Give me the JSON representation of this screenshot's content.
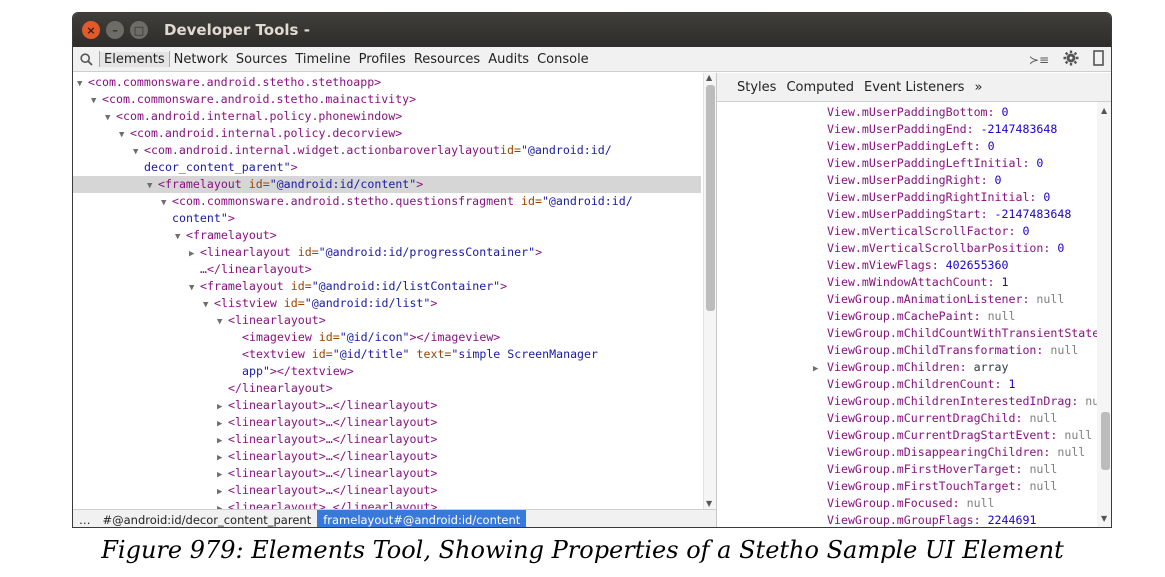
{
  "window": {
    "title": "Developer Tools -",
    "close_glyph": "×",
    "minimize_glyph": "–",
    "maximize_glyph": "□"
  },
  "toolbar": {
    "search_icon": "🔍",
    "tabs": [
      "Elements",
      "Network",
      "Sources",
      "Timeline",
      "Profiles",
      "Resources",
      "Audits",
      "Console"
    ],
    "active_tab": "Elements",
    "right_icons": {
      "console_drawer": "≻≡",
      "settings": "✱",
      "device": "▯"
    }
  },
  "elements_tree": [
    {
      "indent": 0,
      "exp": "▼",
      "tag": "<com.commonsware.android.stetho.stethoapp>"
    },
    {
      "indent": 1,
      "exp": "▼",
      "tag": "<com.commonsware.android.stetho.mainactivity>"
    },
    {
      "indent": 2,
      "exp": "▼",
      "tag": "<com.android.internal.policy.phonewindow>"
    },
    {
      "indent": 3,
      "exp": "▼",
      "tag": "<com.android.internal.policy.decorview>"
    },
    {
      "indent": 4,
      "exp": "▼",
      "tag": "<com.android.internal.widget.actionbaroverlaylayout",
      "attr": "id=",
      "val": "\"@android:id/"
    },
    {
      "indent": 4,
      "exp": "",
      "tag": "",
      "val": "decor_content_parent\"",
      "tail": ">"
    },
    {
      "indent": 5,
      "exp": "▼",
      "tag": "<framelayout",
      "attr": " id=",
      "val": "\"@android:id/content\"",
      "tail": ">",
      "sel": true
    },
    {
      "indent": 6,
      "exp": "▼",
      "tag": "<com.commonsware.android.stetho.questionsfragment",
      "attr": " id=",
      "val": "\"@android:id/"
    },
    {
      "indent": 6,
      "exp": "",
      "tag": "",
      "val": "content\"",
      "tail": ">"
    },
    {
      "indent": 7,
      "exp": "▼",
      "tag": "<framelayout>"
    },
    {
      "indent": 8,
      "exp": "▶",
      "tag": "<linearlayout",
      "attr": " id=",
      "val": "\"@android:id/progressContainer\"",
      "tail": ">"
    },
    {
      "indent": 8,
      "exp": "",
      "tag": "…</linearlayout>"
    },
    {
      "indent": 8,
      "exp": "▼",
      "tag": "<framelayout",
      "attr": " id=",
      "val": "\"@android:id/listContainer\"",
      "tail": ">"
    },
    {
      "indent": 9,
      "exp": "▼",
      "tag": "<listview",
      "attr": " id=",
      "val": "\"@android:id/list\"",
      "tail": ">"
    },
    {
      "indent": 10,
      "exp": "▼",
      "tag": "<linearlayout>"
    },
    {
      "indent": 11,
      "exp": "",
      "tag": "<imageview",
      "attr": " id=",
      "val": "\"@id/icon\"",
      "tail": "></imageview>"
    },
    {
      "indent": 11,
      "exp": "",
      "tag": "<textview",
      "attr": " id=",
      "val": "\"@id/title\"",
      "attr2": " text=",
      "val2": "\"simple ScreenManager"
    },
    {
      "indent": 11,
      "exp": "",
      "tag": "",
      "val": "app\"",
      "tail": "></textview>"
    },
    {
      "indent": 10,
      "exp": "",
      "tag": "</linearlayout>"
    },
    {
      "indent": 10,
      "exp": "▶",
      "tag": "<linearlayout>…</linearlayout>"
    },
    {
      "indent": 10,
      "exp": "▶",
      "tag": "<linearlayout>…</linearlayout>"
    },
    {
      "indent": 10,
      "exp": "▶",
      "tag": "<linearlayout>…</linearlayout>"
    },
    {
      "indent": 10,
      "exp": "▶",
      "tag": "<linearlayout>…</linearlayout>"
    },
    {
      "indent": 10,
      "exp": "▶",
      "tag": "<linearlayout>…</linearlayout>"
    },
    {
      "indent": 10,
      "exp": "▶",
      "tag": "<linearlayout>…</linearlayout>"
    },
    {
      "indent": 10,
      "exp": "▶",
      "tag": "<linearlayout>…</linearlayout>"
    }
  ],
  "breadcrumb": {
    "ellipsis": "…",
    "items": [
      "#@android:id/decor_content_parent",
      "framelayout#@android:id/content"
    ],
    "active_index": 1
  },
  "right_panel": {
    "tabs": [
      "Styles",
      "Computed",
      "Event Listeners",
      "»"
    ],
    "properties": [
      {
        "name": "View.mUserPaddingBottom",
        "value": "0",
        "kind": "num"
      },
      {
        "name": "View.mUserPaddingEnd",
        "value": "-2147483648",
        "kind": "num"
      },
      {
        "name": "View.mUserPaddingLeft",
        "value": "0",
        "kind": "num"
      },
      {
        "name": "View.mUserPaddingLeftInitial",
        "value": "0",
        "kind": "num"
      },
      {
        "name": "View.mUserPaddingRight",
        "value": "0",
        "kind": "num"
      },
      {
        "name": "View.mUserPaddingRightInitial",
        "value": "0",
        "kind": "num"
      },
      {
        "name": "View.mUserPaddingStart",
        "value": "-2147483648",
        "kind": "num"
      },
      {
        "name": "View.mVerticalScrollFactor",
        "value": "0",
        "kind": "num"
      },
      {
        "name": "View.mVerticalScrollbarPosition",
        "value": "0",
        "kind": "num"
      },
      {
        "name": "View.mViewFlags",
        "value": "402655360",
        "kind": "num"
      },
      {
        "name": "View.mWindowAttachCount",
        "value": "1",
        "kind": "num"
      },
      {
        "name": "ViewGroup.mAnimationListener",
        "value": "null",
        "kind": "null"
      },
      {
        "name": "ViewGroup.mCachePaint",
        "value": "null",
        "kind": "null"
      },
      {
        "name": "ViewGroup.mChildCountWithTransientState",
        "value": "…",
        "kind": "str"
      },
      {
        "name": "ViewGroup.mChildTransformation",
        "value": "null",
        "kind": "null"
      },
      {
        "name": "ViewGroup.mChildren",
        "value": "array",
        "kind": "str",
        "expander": "▶"
      },
      {
        "name": "ViewGroup.mChildrenCount",
        "value": "1",
        "kind": "num"
      },
      {
        "name": "ViewGroup.mChildrenInterestedInDrag",
        "value": "null",
        "kind": "null"
      },
      {
        "name": "ViewGroup.mCurrentDragChild",
        "value": "null",
        "kind": "null"
      },
      {
        "name": "ViewGroup.mCurrentDragStartEvent",
        "value": "null",
        "kind": "null"
      },
      {
        "name": "ViewGroup.mDisappearingChildren",
        "value": "null",
        "kind": "null"
      },
      {
        "name": "ViewGroup.mFirstHoverTarget",
        "value": "null",
        "kind": "null"
      },
      {
        "name": "ViewGroup.mFirstTouchTarget",
        "value": "null",
        "kind": "null"
      },
      {
        "name": "ViewGroup.mFocused",
        "value": "null",
        "kind": "null"
      },
      {
        "name": "ViewGroup.mGroupFlags",
        "value": "2244691",
        "kind": "num"
      }
    ]
  },
  "caption": "Figure 979: Elements Tool, Showing Properties of a Stetho Sample UI Element"
}
